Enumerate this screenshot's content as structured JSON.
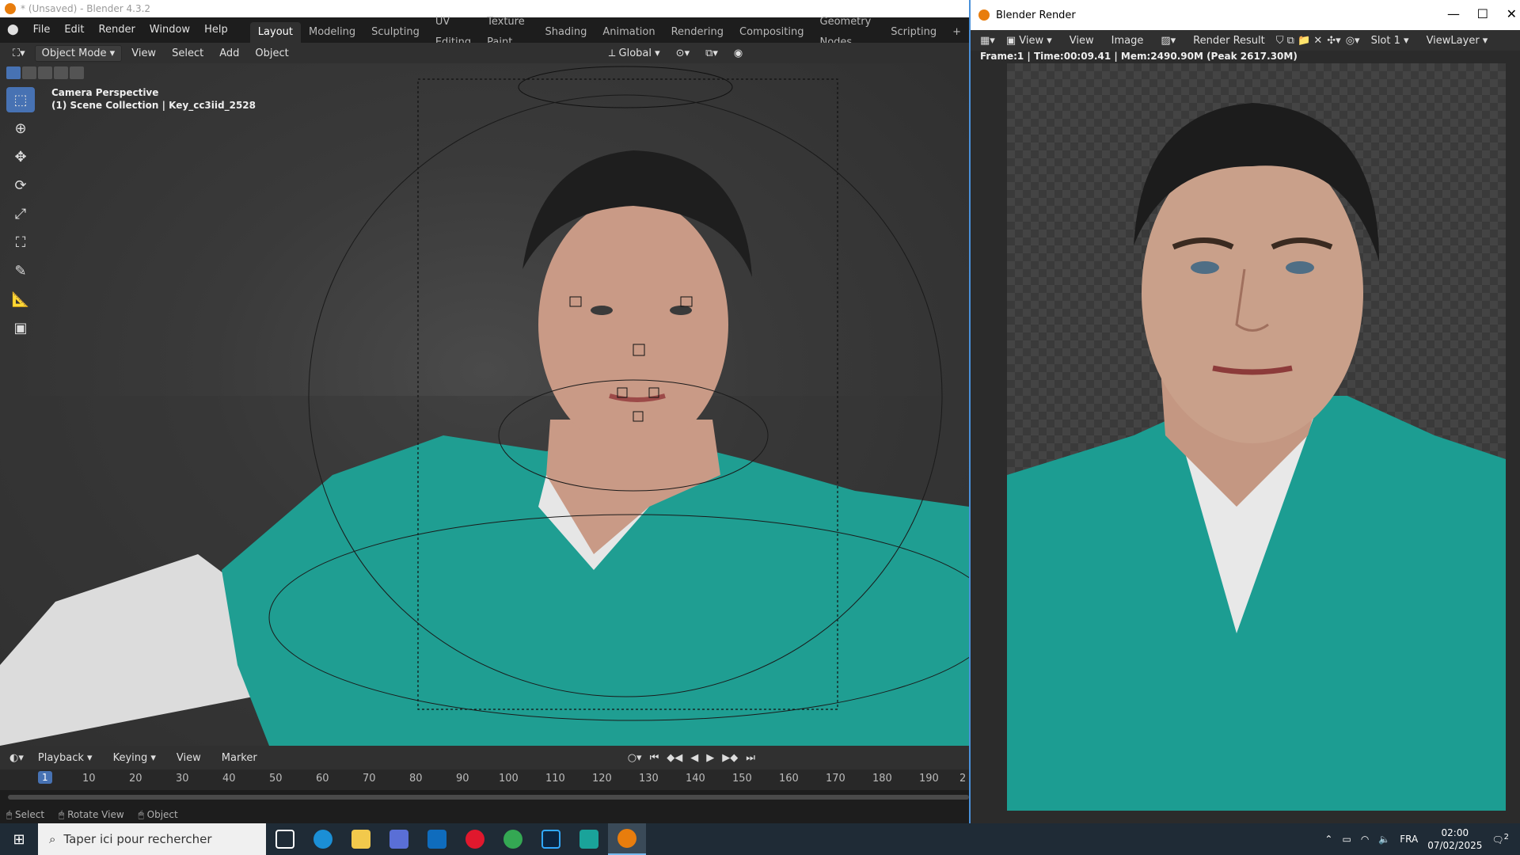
{
  "window": {
    "title": "* (Unsaved) - Blender 4.3.2"
  },
  "menu": [
    "File",
    "Edit",
    "Render",
    "Window",
    "Help"
  ],
  "workspaces": [
    "Layout",
    "Modeling",
    "Sculpting",
    "UV Editing",
    "Texture Paint",
    "Shading",
    "Animation",
    "Rendering",
    "Compositing",
    "Geometry Nodes",
    "Scripting"
  ],
  "active_workspace": "Layout",
  "header": {
    "mode": "Object Mode",
    "view": "View",
    "select": "Select",
    "add": "Add",
    "object": "Object",
    "orientation": "Global"
  },
  "viewport": {
    "line1": "Camera Perspective",
    "line2": "(1) Scene Collection | Key_cc3iid_2528"
  },
  "timeline": {
    "playback": "Playback",
    "keying": "Keying",
    "view": "View",
    "marker": "Marker",
    "current_frame": "1",
    "ticks": [
      "10",
      "20",
      "30",
      "40",
      "50",
      "60",
      "70",
      "80",
      "90",
      "100",
      "110",
      "120",
      "130",
      "140",
      "150",
      "160",
      "170",
      "180",
      "190",
      "2"
    ]
  },
  "status": {
    "select": "Select",
    "rotate": "Rotate View",
    "object": "Object"
  },
  "render": {
    "title": "Blender Render",
    "view1": "View",
    "view2": "View",
    "image": "Image",
    "result": "Render Result",
    "slot": "Slot 1",
    "layer": "ViewLayer",
    "info": "Frame:1 | Time:00:09.41 | Mem:2490.90M (Peak 2617.30M)"
  },
  "taskbar": {
    "search_placeholder": "Taper ici pour rechercher",
    "lang": "FRA",
    "time": "02:00",
    "date": "07/02/2025",
    "notif": "2"
  }
}
